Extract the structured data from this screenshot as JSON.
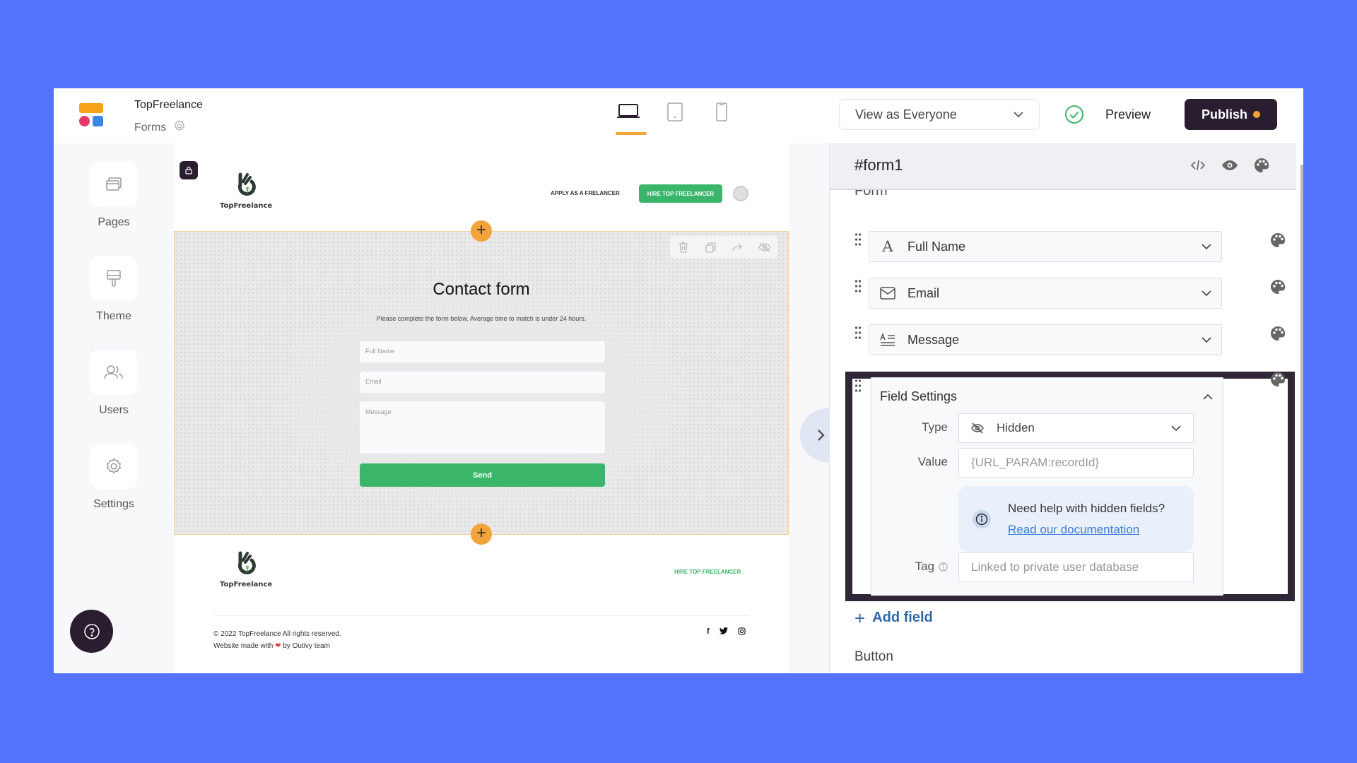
{
  "header": {
    "app_name": "TopFreelance",
    "section": "Forms",
    "device_tabs": [
      {
        "name": "desktop",
        "active": true
      },
      {
        "name": "tablet",
        "active": false
      },
      {
        "name": "mobile",
        "active": false
      }
    ],
    "view_as": "View as Everyone",
    "preview_label": "Preview",
    "publish_label": "Publish"
  },
  "sidebar": {
    "items": [
      {
        "label": "Pages",
        "icon": "pages-icon"
      },
      {
        "label": "Theme",
        "icon": "paint-roller-icon"
      },
      {
        "label": "Users",
        "icon": "users-icon"
      },
      {
        "label": "Settings",
        "icon": "gear-icon"
      }
    ]
  },
  "site": {
    "logo_name": "TopFreelance",
    "nav_link": "APPLY AS A FRELANCER",
    "hire_button": "HIRE TOP FREELANCER",
    "form": {
      "title": "Contact form",
      "description": "Please complete the form below. Average time to match is under 24 hours.",
      "full_name_placeholder": "Full Name",
      "email_placeholder": "Email",
      "message_placeholder": "Message",
      "send_label": "Send"
    },
    "footer": {
      "hire_link": "HIRE TOP FREELANCER",
      "copyright": "© 2022 TopFreelance All rights reserved.",
      "made_with_prefix": "Website made with",
      "made_with_suffix": "by Outivy team",
      "socials": [
        "f",
        "t",
        "ig"
      ]
    }
  },
  "panel": {
    "title": "#form1",
    "section_label": "Form",
    "fields": [
      {
        "label": "Full Name",
        "icon": "text-icon"
      },
      {
        "label": "Email",
        "icon": "envelope-icon"
      },
      {
        "label": "Message",
        "icon": "textarea-icon"
      }
    ],
    "field_settings": {
      "title": "Field Settings",
      "type_label": "Type",
      "type_value": "Hidden",
      "value_label": "Value",
      "value_value": "{URL_PARAM:recordId}",
      "help_question": "Need help with hidden fields?",
      "help_link": "Read our documentation",
      "tag_label": "Tag",
      "tag_placeholder": "Linked to private user database"
    },
    "add_field_label": "Add field",
    "button_section_label": "Button"
  },
  "colors": {
    "background": "#5373fe",
    "accent": "#f0a43a",
    "dark": "#2b1d30",
    "green": "#3bb56a",
    "link": "#3c7fd7"
  }
}
